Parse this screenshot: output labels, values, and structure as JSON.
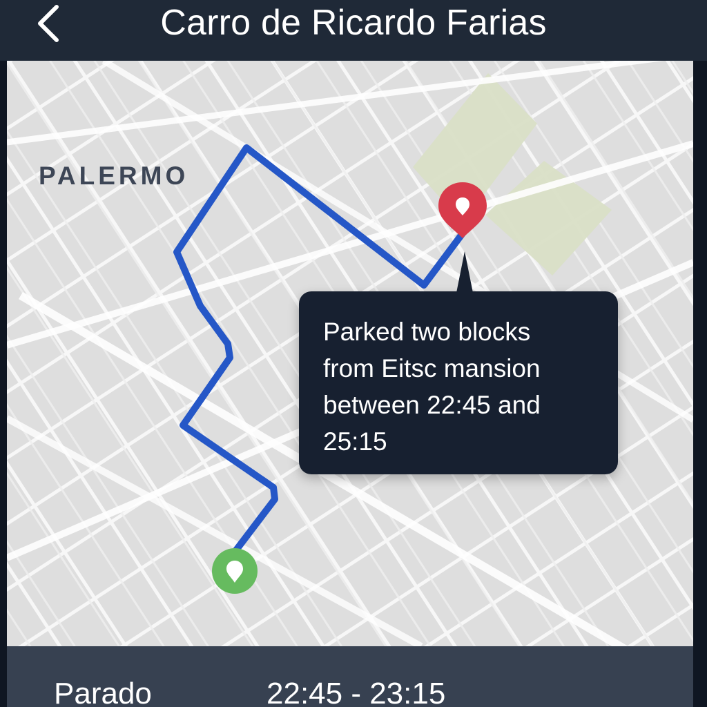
{
  "header": {
    "title": "Carro de Ricardo Farias",
    "back_icon": "chevron-left-icon"
  },
  "map": {
    "district_label": "PALERMO",
    "route_color": "#2557c7",
    "start_marker": {
      "icon": "start-pin-icon",
      "color": "#66bb5f"
    },
    "end_marker": {
      "icon": "end-pin-icon",
      "color": "#d83b4b"
    },
    "callout": {
      "line_1": "Parked two blocks",
      "line_2": "from Eitsc  mansion",
      "line_3": "between 22:45 and",
      "line_4": "25:15"
    }
  },
  "status": {
    "label": "Parado",
    "time_range": "22:45 - 23:15"
  },
  "colors": {
    "header_bg": "#1f2937",
    "map_bg": "#dcdcdc",
    "park": "#d8dfc3",
    "callout_bg": "#172030",
    "bottom_bg": "#374151"
  }
}
